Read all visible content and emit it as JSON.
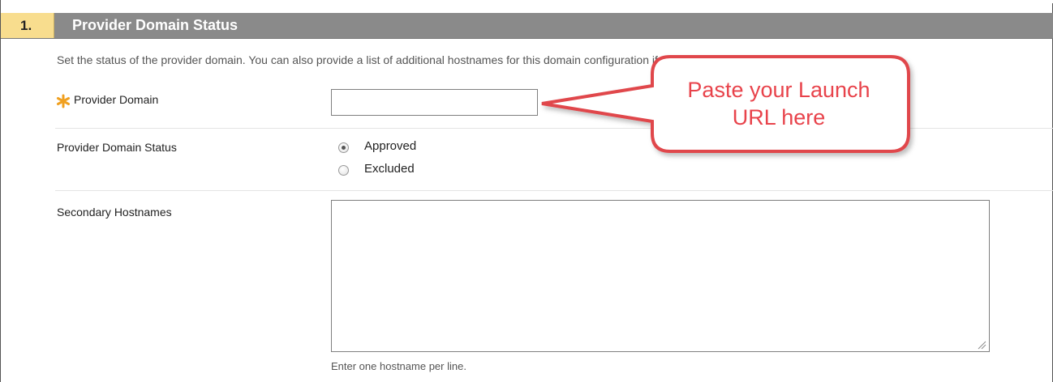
{
  "section": {
    "number": "1.",
    "title": "Provider Domain Status",
    "description": "Set the status of the provider domain. You can also provide a list of additional hostnames for this domain configuration if needed."
  },
  "provider_domain": {
    "label": "Provider Domain",
    "required": true,
    "value": "",
    "required_icon": "asterisk-icon"
  },
  "status": {
    "label": "Provider Domain Status",
    "options": [
      {
        "label": "Approved",
        "checked": true
      },
      {
        "label": "Excluded",
        "checked": false
      }
    ]
  },
  "secondary_hostnames": {
    "label": "Secondary Hostnames",
    "value": "",
    "help": "Enter one hostname per line."
  },
  "callout": {
    "line1": "Paste your Launch",
    "line2": "URL here"
  },
  "colors": {
    "header_bg": "#8a8a8a",
    "step_bg": "#f8dd8e",
    "required_star": "#f0a020",
    "callout_border": "#e0474c",
    "callout_text": "#e8434b"
  }
}
